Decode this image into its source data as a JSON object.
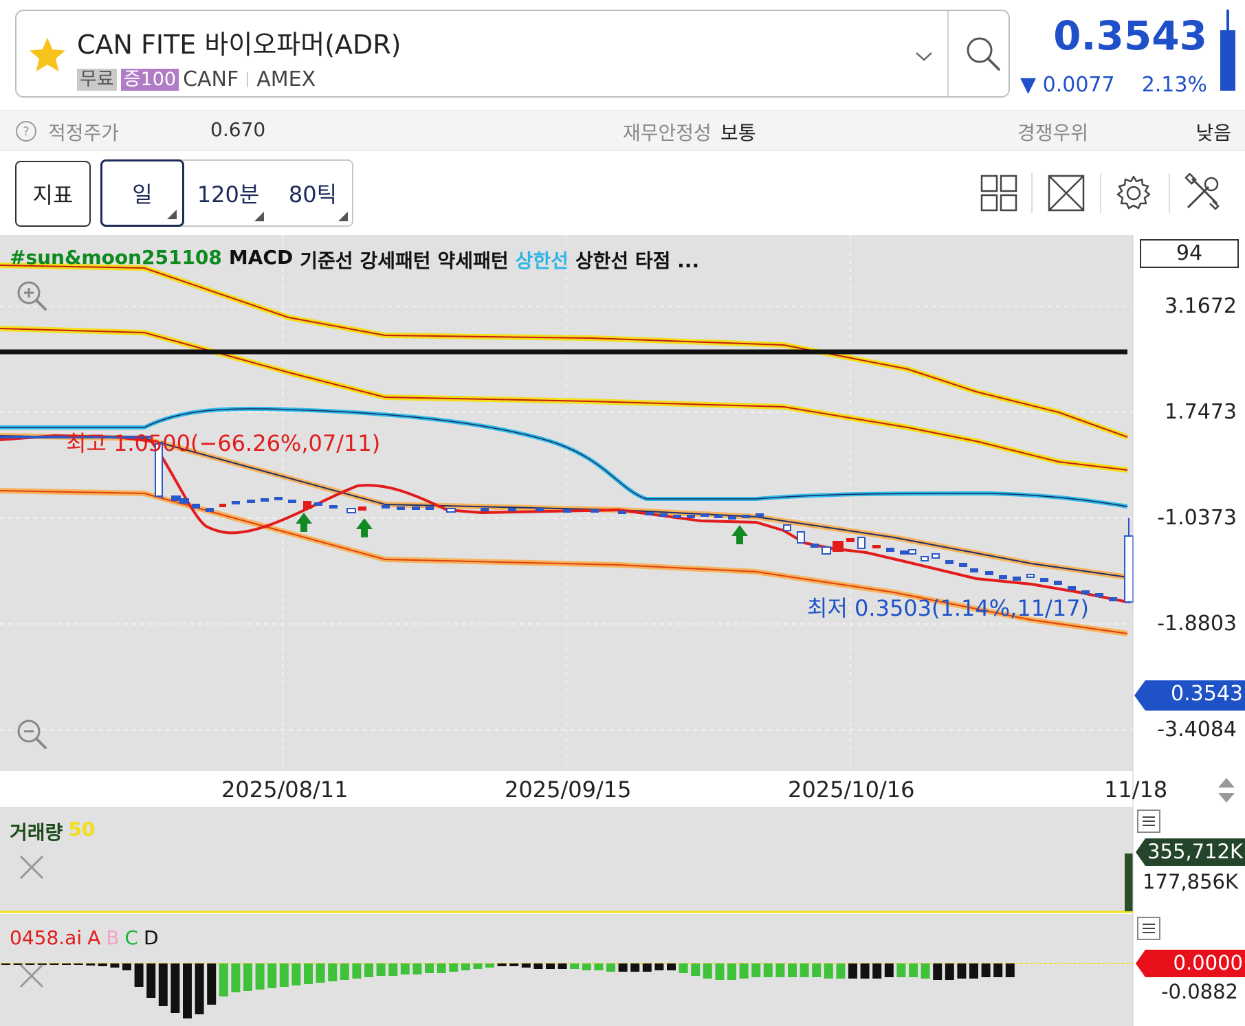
{
  "header": {
    "stock_name": "CAN FITE 바이오파머(ADR)",
    "tag_free": "무료",
    "tag_margin": "증100",
    "ticker": "CANF",
    "exchange": "AMEX",
    "star_icon": "star-icon",
    "search_icon": "search-icon"
  },
  "quote": {
    "price": "0.3543",
    "change": "▼ 0.0077",
    "change_pct": "2.13%",
    "color": "#1f4fc9"
  },
  "info": {
    "fair_price_label": "적정주가",
    "fair_price_value": "0.670",
    "financial_label": "재무안정성",
    "financial_value": "보통",
    "competition_label": "경쟁우위",
    "competition_value": "낮음"
  },
  "toolbar": {
    "indicator_label": "지표",
    "period_day": "일",
    "period_120": "120분",
    "period_80": "80틱"
  },
  "chart": {
    "legend": {
      "sun_moon": "#sun&moon251108",
      "macd": "MACD",
      "base": "기준선",
      "strong": "강세패턴",
      "weak": "약세패턴",
      "upper_cyan": "상한선",
      "upper_touch": "상한선 타점 ..."
    },
    "value_box": "94",
    "y_labels": [
      "3.1672",
      "1.7473",
      "-1.0373",
      "-1.8803",
      "-3.4084"
    ],
    "current_price_label": "0.3543",
    "high_annotation": "최고 1.0500(−66.26%,07/11)",
    "low_annotation": "최저 0.3503(1.14%,11/17)",
    "x_labels": [
      "2025/08/11",
      "2025/09/15",
      "2025/10/16",
      "11/18"
    ],
    "volume": {
      "label": "거래량",
      "period": "50",
      "max_label": "355,712K",
      "mid_label": "177,856K"
    },
    "indicator2": {
      "name": "0458.ai",
      "a": "A",
      "b": "B",
      "c": "C",
      "d": "D",
      "value_label": "0.0000",
      "low_label": "-0.0882"
    }
  },
  "chart_data": {
    "type": "line",
    "title": "",
    "xlabel": "",
    "ylabel": "",
    "x_ticks": [
      "2025/08/11",
      "2025/09/15",
      "2025/10/16",
      "11/18"
    ],
    "price": {
      "last": 0.3543,
      "high": 1.05,
      "high_date": "07/11",
      "low": 0.3503,
      "low_date": "11/17"
    },
    "volume": {
      "last": 355712,
      "unit": "K"
    },
    "indicator": {
      "last": 0.0,
      "min": -0.0882
    }
  }
}
